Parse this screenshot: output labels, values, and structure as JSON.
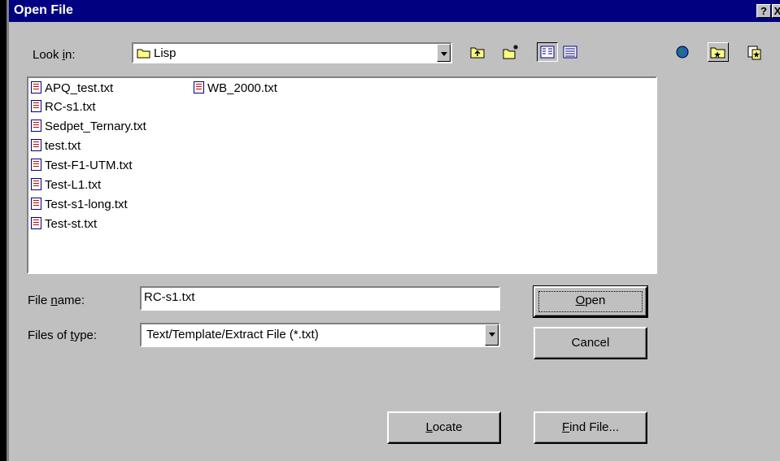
{
  "window": {
    "title": "Open File",
    "help_button": "?",
    "close_button": "X"
  },
  "look_in": {
    "label_pre": "Look ",
    "label_mnemonic": "i",
    "label_post": "n:",
    "value": "Lisp"
  },
  "toolbar": {
    "icons": [
      "up-one-level-icon",
      "create-new-folder-icon",
      "list-view-icon",
      "details-view-icon"
    ]
  },
  "right_toolbar": {
    "icons": [
      "globe-search-icon",
      "folder-favorite-icon",
      "add-to-favorites-icon"
    ]
  },
  "files": [
    {
      "name": "APQ_test.txt"
    },
    {
      "name": "RC-s1.txt"
    },
    {
      "name": "Sedpet_Ternary.txt"
    },
    {
      "name": "test.txt"
    },
    {
      "name": "Test-F1-UTM.txt"
    },
    {
      "name": "Test-L1.txt"
    },
    {
      "name": "Test-s1-long.txt"
    },
    {
      "name": "Test-st.txt"
    },
    {
      "name": "WB_2000.txt"
    }
  ],
  "file_name": {
    "label_pre": "File ",
    "label_mnemonic": "n",
    "label_post": "ame:",
    "value": "RC-s1.txt"
  },
  "file_type": {
    "label_pre": "Files of ",
    "label_mnemonic": "t",
    "label_post": "ype:",
    "value": "Text/Template/Extract File (*.txt)"
  },
  "buttons": {
    "open": {
      "mnemonic": "O",
      "rest": "pen"
    },
    "cancel": "Cancel",
    "locate": {
      "mnemonic": "L",
      "rest": "ocate"
    },
    "find_file": {
      "mnemonic": "F",
      "rest": "ind File..."
    }
  }
}
